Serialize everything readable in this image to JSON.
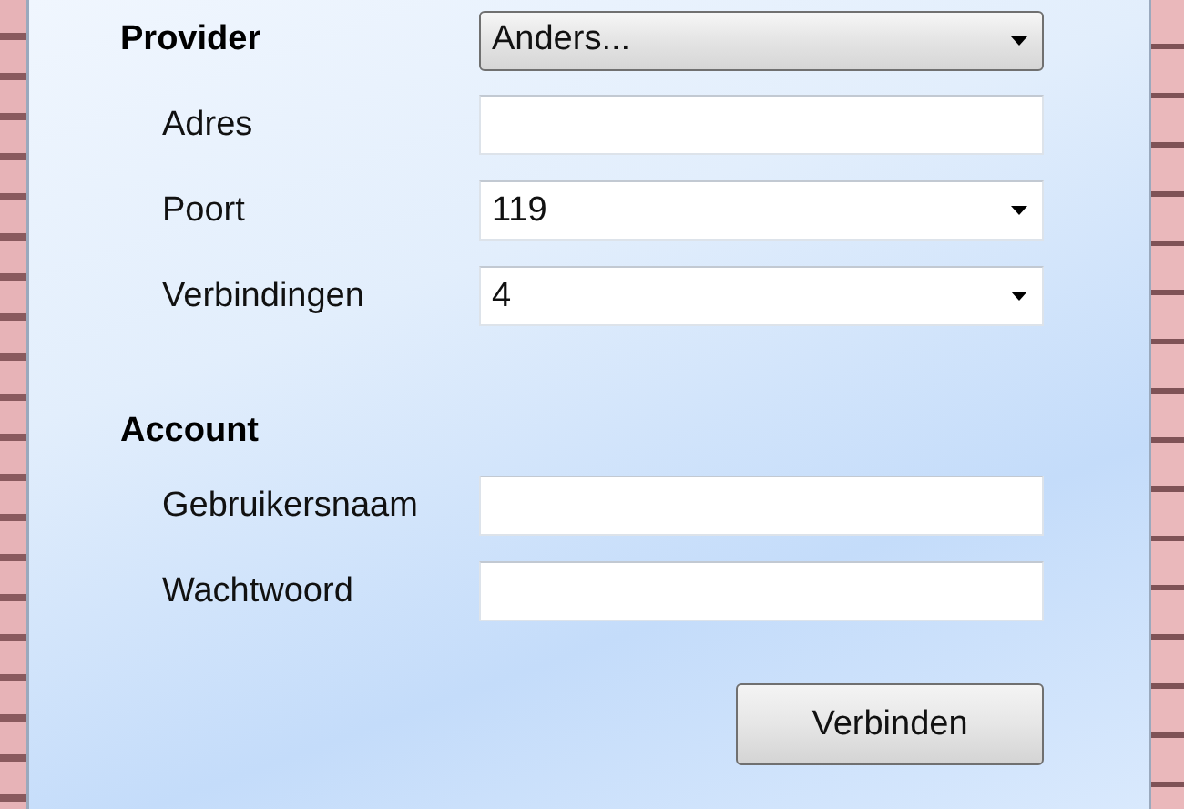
{
  "sections": [
    {
      "title": "Provider",
      "select": {
        "kind": "select",
        "value": "Anders..."
      },
      "fields": [
        {
          "label": "Adres",
          "kind": "text"
        },
        {
          "label": "Poort",
          "kind": "combo",
          "value": "119"
        },
        {
          "label": "Verbindingen",
          "kind": "combo",
          "value": "4"
        }
      ]
    },
    {
      "title": "Account",
      "fields": [
        {
          "label": "Gebruikersnaam",
          "kind": "text"
        },
        {
          "label": "Wachtwoord",
          "kind": "text"
        }
      ]
    }
  ],
  "button": "Verbinden"
}
